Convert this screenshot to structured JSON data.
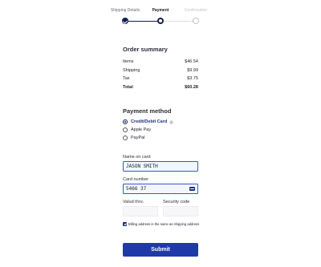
{
  "stepper": {
    "steps": [
      {
        "label": "Shipping Details",
        "state": "done"
      },
      {
        "label": "Payment",
        "state": "active"
      },
      {
        "label": "Confirmation",
        "state": "todo"
      }
    ]
  },
  "order_summary": {
    "title": "Order summary",
    "rows": [
      {
        "label": "Items",
        "value": "$46.54"
      },
      {
        "label": "Shipping",
        "value": "$9.99"
      },
      {
        "label": "Tax",
        "value": "$3.75"
      }
    ],
    "total": {
      "label": "Total",
      "value": "$60.28"
    }
  },
  "payment": {
    "title": "Payment method",
    "options": [
      {
        "label": "Credit/Debit Card",
        "selected": true
      },
      {
        "label": "Apple Pay",
        "selected": false
      },
      {
        "label": "PayPal",
        "selected": false
      }
    ],
    "info_glyph": "i"
  },
  "form": {
    "name_label": "Name on card",
    "name_value": "JASON SMITH",
    "card_label": "Card number",
    "card_value": "5466 37",
    "valid_label": "Valud thru.",
    "valid_value": "",
    "security_label": "Security code",
    "security_value": "",
    "billing_same_label": "Billing address is the same as shipping address",
    "billing_same_checked": true
  },
  "submit_label": "Submit",
  "colors": {
    "accent": "#1d3aa8",
    "dark_navy": "#0f1f4d",
    "field_border_active": "#2f58d6"
  }
}
